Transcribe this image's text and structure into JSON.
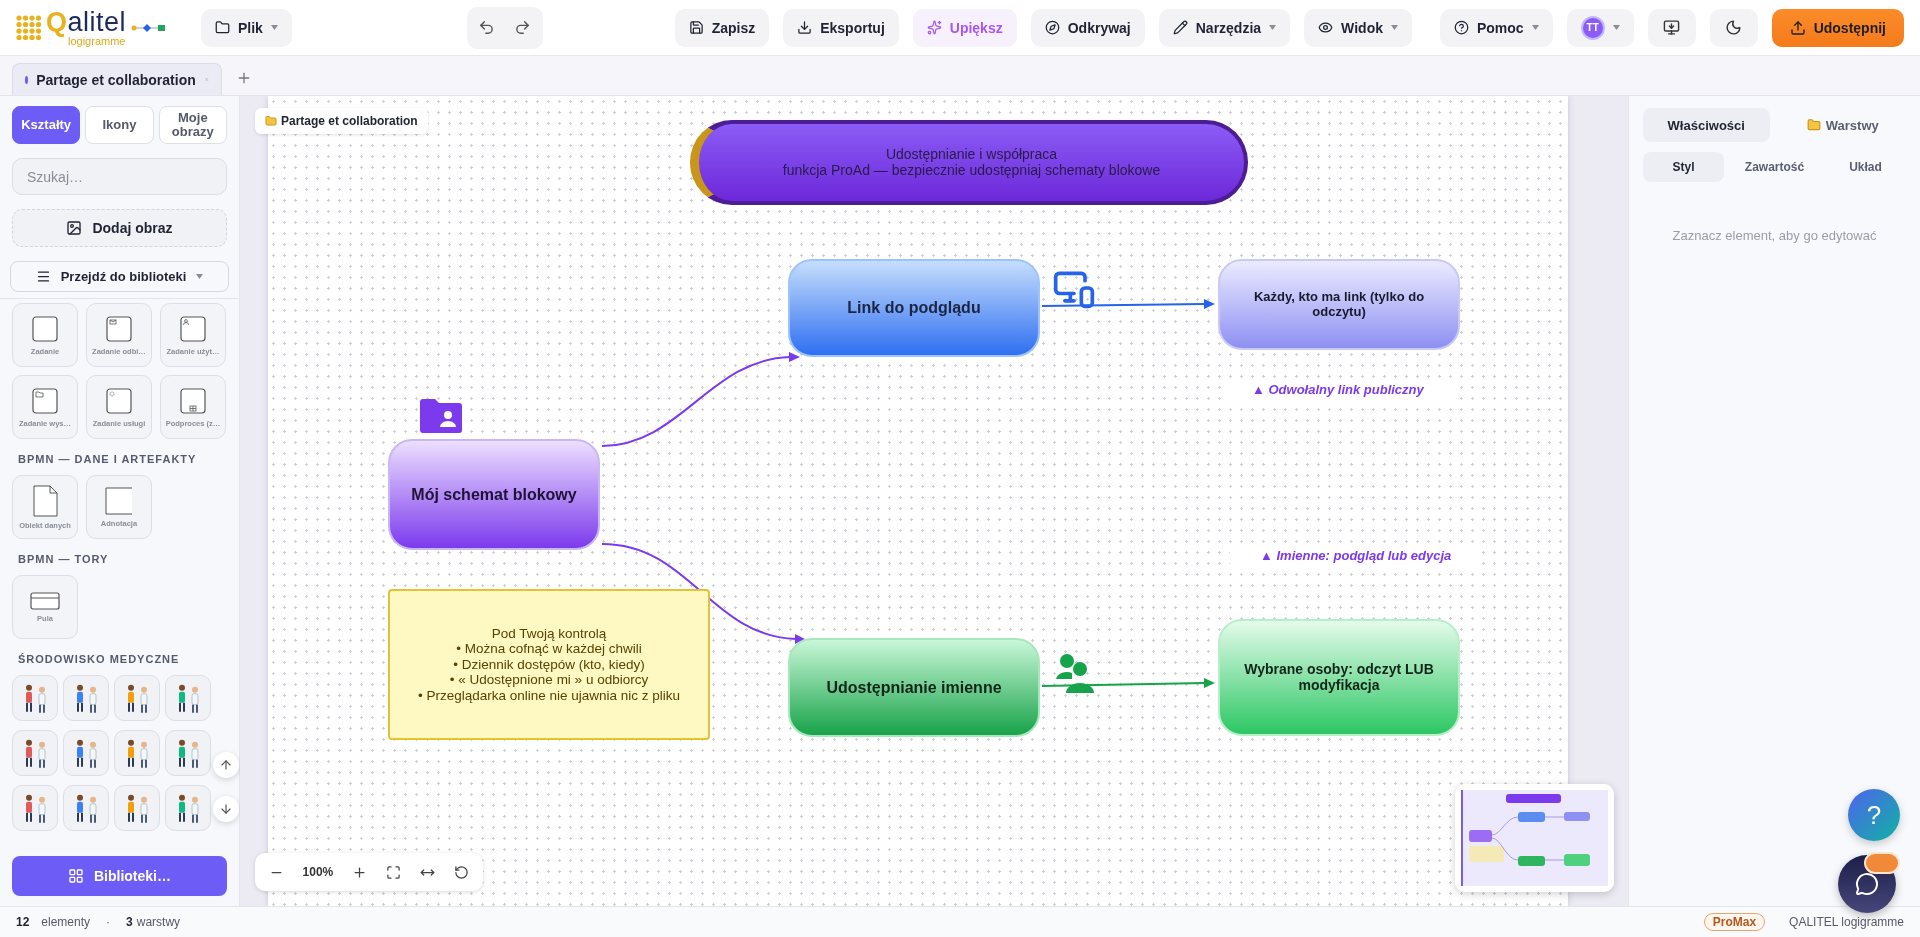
{
  "header": {
    "logo": {
      "name": "Qalitel",
      "tagline": "logigramme"
    },
    "file_menu": {
      "label": "Plik",
      "caret": true
    },
    "actions": [
      {
        "label": "Zapisz",
        "kind": "plain",
        "caret": false
      },
      {
        "label": "Eksportuj",
        "kind": "plain",
        "caret": false
      },
      {
        "label": "Upiększ",
        "kind": "accent",
        "caret": false
      },
      {
        "label": "Odkrywaj",
        "kind": "plain",
        "caret": false
      },
      {
        "label": "Narzędzia",
        "kind": "plain",
        "caret": true
      },
      {
        "label": "Widok",
        "kind": "plain",
        "caret": true
      }
    ],
    "help": {
      "label": "Pomoc",
      "caret": true
    },
    "user": {
      "initials": "TT",
      "caret": true
    },
    "share": {
      "label": "Udostępnij"
    }
  },
  "tabs": [
    {
      "label": "Partage et collaboration",
      "selected": true
    }
  ],
  "sidebar": {
    "tabs": [
      {
        "label": "Kształty",
        "selected": true
      },
      {
        "label": "Ikony",
        "selected": false
      },
      {
        "label": "Moje obrazy",
        "selected": false
      }
    ],
    "search": {
      "placeholder": "Szukaj…"
    },
    "add_image": "Dodaj obraz",
    "library_picker": {
      "label": "Przejdź do biblioteki",
      "caret": true
    },
    "groups": [
      {
        "tiles": [
          {
            "kind": "task",
            "label": "Zadanie"
          },
          {
            "kind": "receive",
            "label": "Zadanie odbi…"
          },
          {
            "kind": "user",
            "label": "Zadanie użyt…"
          },
          {
            "kind": "send",
            "label": "Zadanie wys…"
          },
          {
            "kind": "service",
            "label": "Zadanie usługi"
          },
          {
            "kind": "subprocess",
            "label": "Podproces (z…"
          }
        ]
      },
      {
        "title": "BPMN — DANE I ARTEFAKTY",
        "tiles": [
          {
            "kind": "data",
            "label": "Obiekt danych"
          },
          {
            "kind": "annotation",
            "label": "Adnotacja"
          }
        ]
      },
      {
        "title": "BPMN — TORY",
        "tiles": [
          {
            "kind": "pool",
            "label": "Pula"
          }
        ]
      },
      {
        "title": "ŚRODOWISKO MEDYCZNE",
        "tiles": [
          {
            "kind": "scene"
          },
          {
            "kind": "scene"
          },
          {
            "kind": "scene"
          },
          {
            "kind": "scene"
          },
          {
            "kind": "scene"
          },
          {
            "kind": "scene"
          },
          {
            "kind": "scene"
          },
          {
            "kind": "scene"
          },
          {
            "kind": "scene"
          },
          {
            "kind": "scene"
          },
          {
            "kind": "scene"
          },
          {
            "kind": "scene"
          }
        ]
      }
    ],
    "libraries_button": "Biblioteki…"
  },
  "canvas": {
    "breadcrumb": "Partage et collaboration",
    "nodes": [
      {
        "kind": "banner",
        "lines": [
          "Udostępnianie i współpraca",
          "funkcja ProAd — bezpiecznie udostępniaj schematy blokowe"
        ]
      },
      {
        "kind": "blue",
        "lines": [
          "Link do podglądu"
        ]
      },
      {
        "kind": "lavender",
        "lines": [
          "Każdy, kto ma link (tylko do odczytu)"
        ]
      },
      {
        "kind": "violet",
        "lines": [
          "Mój schemat blokowy"
        ]
      },
      {
        "kind": "note",
        "lines": [
          "Pod Twoją kontrolą",
          "• Można cofnąć w każdej chwili",
          "• Dziennik dostępów (kto, kiedy)",
          "• « Udostępnione mi » u odbiorcy",
          "• Przeglądarka online nie ujawnia nic z pliku"
        ]
      },
      {
        "kind": "green",
        "lines": [
          "Udostępnianie imienne"
        ]
      },
      {
        "kind": "mint",
        "lines": [
          "Wybrane osoby: odczyt LUB modyfikacja"
        ]
      }
    ],
    "edge_labels": [
      "▲ Odwołalny link publiczny",
      "▲ Imienne: podgląd lub edycja"
    ],
    "zoom": "100%"
  },
  "right_panel": {
    "tabs": [
      {
        "label": "Właściwości",
        "selected": true
      },
      {
        "label": "Warstwy",
        "selected": false
      }
    ],
    "subtabs": [
      {
        "label": "Styl",
        "selected": true
      },
      {
        "label": "Zawartość",
        "selected": false
      },
      {
        "label": "Układ",
        "selected": false
      }
    ],
    "hint": "Zaznacz element, aby go edytować"
  },
  "help_button": "?",
  "status_bar": {
    "element_count": "12",
    "elements_label": "elementy",
    "separator": "·",
    "layer_count": "3",
    "layers_label": "warstwy",
    "plan": "ProMax",
    "app_name": "QALITEL logigramme"
  }
}
